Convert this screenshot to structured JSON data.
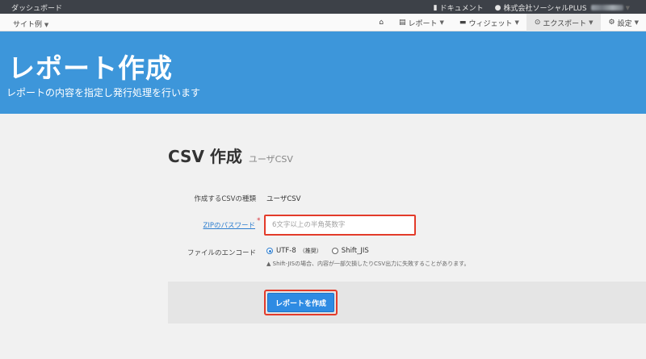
{
  "topbar": {
    "dashboard": "ダッシュボード",
    "docs": "ドキュメント",
    "account": "株式会社ソーシャルPLUS",
    "docs_icon": "book-icon",
    "account_icon": "user-icon"
  },
  "navbar": {
    "site": "サイト例",
    "menu": [
      {
        "label": "",
        "icon": "home-icon"
      },
      {
        "label": "レポート",
        "icon": "chart-icon"
      },
      {
        "label": "ウィジェット",
        "icon": "briefcase-icon"
      },
      {
        "label": "エクスポート",
        "icon": "export-icon"
      },
      {
        "label": "設定",
        "icon": "gear-icon"
      }
    ]
  },
  "hero": {
    "title": "レポート作成",
    "subtitle": "レポートの内容を指定し発行処理を行います"
  },
  "page": {
    "title": "CSV 作成",
    "subtitle": "ユーザCSV"
  },
  "form": {
    "type_label": "作成するCSVの種類",
    "type_value": "ユーザCSV",
    "zip_label": "ZIPのパスワード",
    "required_mark": "*",
    "password_placeholder": "6文字以上の半角英数字",
    "encoding_label": "ファイルのエンコード",
    "encoding_options": [
      {
        "label": "UTF-8",
        "tag": "（推奨）",
        "checked": true
      },
      {
        "label": "Shift_JIS",
        "tag": "",
        "checked": false
      }
    ],
    "note": "Shift-JISの場合、内容が一部欠損したりCSV出力に失敗することがあります。",
    "submit_label": "レポートを作成"
  },
  "colors": {
    "hero": "#3d96da",
    "highlight": "#e33b2a",
    "button": "#2e8be3"
  }
}
